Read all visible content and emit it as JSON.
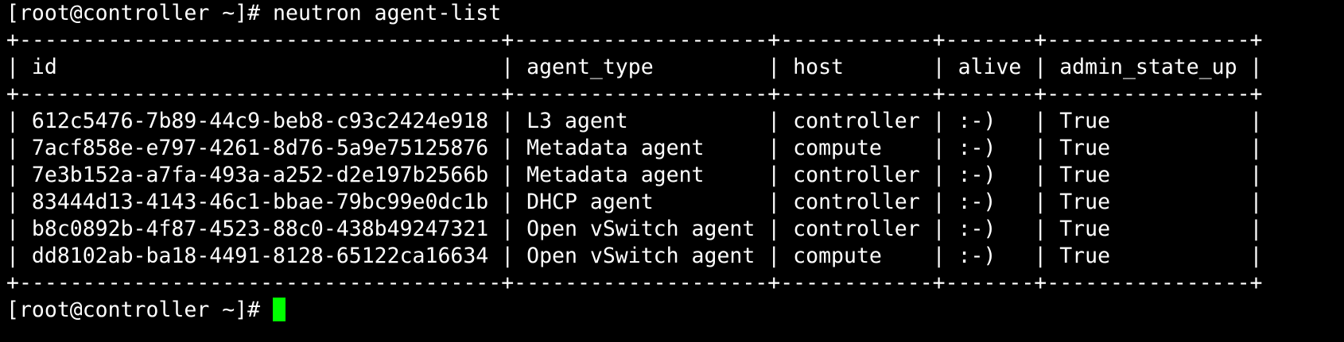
{
  "terminal": {
    "command_line": "[root@controller ~]# neutron agent-list",
    "border": "+--------------------------------------+--------------------+------------+-------+----------------+",
    "header_row": "| id                                   | agent_type         | host       | alive | admin_state_up |",
    "rows": [
      "| 612c5476-7b89-44c9-beb8-c93c2424e918 | L3 agent           | controller | :-)   | True           |",
      "| 7acf858e-e797-4261-8d76-5a9e75125876 | Metadata agent     | compute    | :-)   | True           |",
      "| 7e3b152a-a7fa-493a-a252-d2e197b2566b | Metadata agent     | controller | :-)   | True           |",
      "| 83444d13-4143-46c1-bbae-79bc99e0dc1b | DHCP agent         | controller | :-)   | True           |",
      "| b8c0892b-4f87-4523-88c0-438b49247321 | Open vSwitch agent | controller | :-)   | True           |",
      "| dd8102ab-ba18-4491-8128-65122ca16634 | Open vSwitch agent | compute    | :-)   | True           |"
    ],
    "prompt": "[root@controller ~]# ",
    "cursor_color": "#00ff00",
    "background_color": "#000000",
    "text_color": "#ffffff"
  }
}
